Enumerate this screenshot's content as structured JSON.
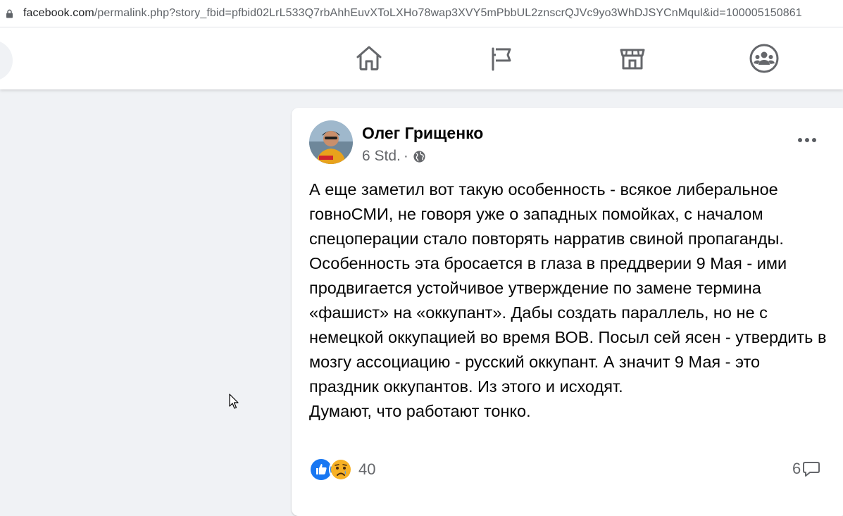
{
  "browser": {
    "url_host": "facebook.com",
    "url_rest": "/permalink.php?story_fbid=pfbid02LrL533Q7rbAhhEuvXToLXHo78wap3XVY5mPbbUL2znscrQJVc9yo3WhDJSYCnMqul&id=100005150861"
  },
  "nav": {
    "icons": [
      "home-icon",
      "pages-flag-icon",
      "marketplace-icon",
      "groups-icon"
    ]
  },
  "post": {
    "author": "Олег Грищенко",
    "time": "6 Std.",
    "separator": "·",
    "privacy_icon": "globe-icon",
    "paragraphs": [
      "А еще заметил вот такую особенность - всякое либеральное говноСМИ, не говоря уже о западных помойках, с началом спецоперации стало повторять нарратив свиной пропаганды. Особенность эта бросается в глаза в преддверии 9 Мая - ими продвигается устойчивое утверждение по замене термина «фашист» на «оккупант». Дабы создать параллель, но не с немецкой оккупацией во время ВОВ. Посыл сей ясен - утвердить в мозгу ассоциацию - русский оккупант. А значит 9 Мая - это праздник оккупантов. Из этого и исходят.",
      "Думают, что работают тонко."
    ],
    "reactions": {
      "icons": [
        "like-icon",
        "sad-icon"
      ],
      "count": "40"
    },
    "comments": {
      "count": "6",
      "icon": "comment-icon"
    }
  },
  "colors": {
    "background": "#f0f2f5",
    "card": "#ffffff",
    "text": "#050505",
    "secondary_text": "#65676b",
    "nav_icon": "#65676b",
    "like_blue": "#1877f2",
    "sad_yellow": "#f7b125"
  }
}
